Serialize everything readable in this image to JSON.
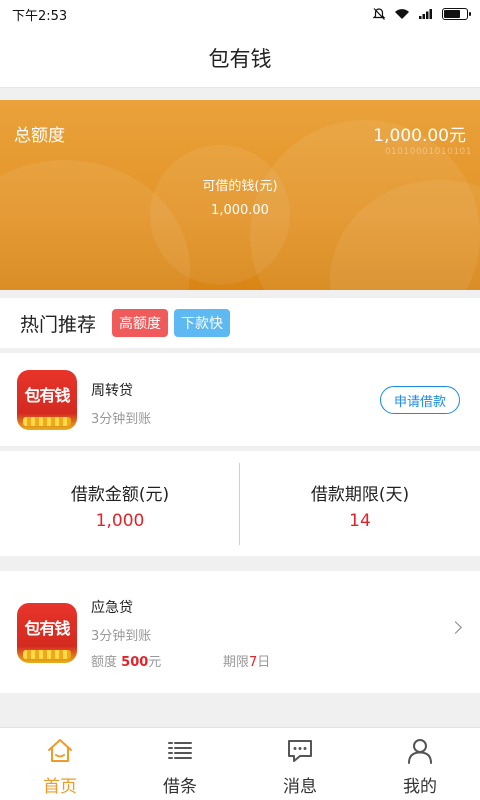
{
  "status_bar": {
    "time": "下午2:53"
  },
  "header": {
    "title": "包有钱"
  },
  "banner": {
    "total_label": "总额度",
    "total_value": "1,000.00元",
    "binary_text": "01010001010101",
    "available_label": "可借的钱(元)",
    "available_value": "1,000.00"
  },
  "hot": {
    "title": "热门推荐",
    "tags": [
      "高额度",
      "下款快"
    ]
  },
  "products": [
    {
      "logo_text": "包有钱",
      "name": "周转贷",
      "subtitle": "3分钟到账",
      "button": "申请借款"
    },
    {
      "logo_text": "包有钱",
      "name": "应急贷",
      "subtitle": "3分钟到账",
      "quota_label": "额度",
      "quota_value": "500",
      "quota_unit": "元",
      "term_label": "期限",
      "term_value": "7",
      "term_unit": "日"
    }
  ],
  "loan_stats": {
    "amount_label": "借款金额(元)",
    "amount_value": "1,000",
    "term_label": "借款期限(天)",
    "term_value": "14"
  },
  "nav": [
    {
      "label": "首页",
      "icon": "home-icon",
      "active": true
    },
    {
      "label": "借条",
      "icon": "list-icon",
      "active": false
    },
    {
      "label": "消息",
      "icon": "message-icon",
      "active": false
    },
    {
      "label": "我的",
      "icon": "user-icon",
      "active": false
    }
  ],
  "colors": {
    "banner": "#e39428",
    "accent_red": "#e3232a",
    "accent_blue": "#1a8ce8",
    "nav_active": "#f19a28"
  }
}
